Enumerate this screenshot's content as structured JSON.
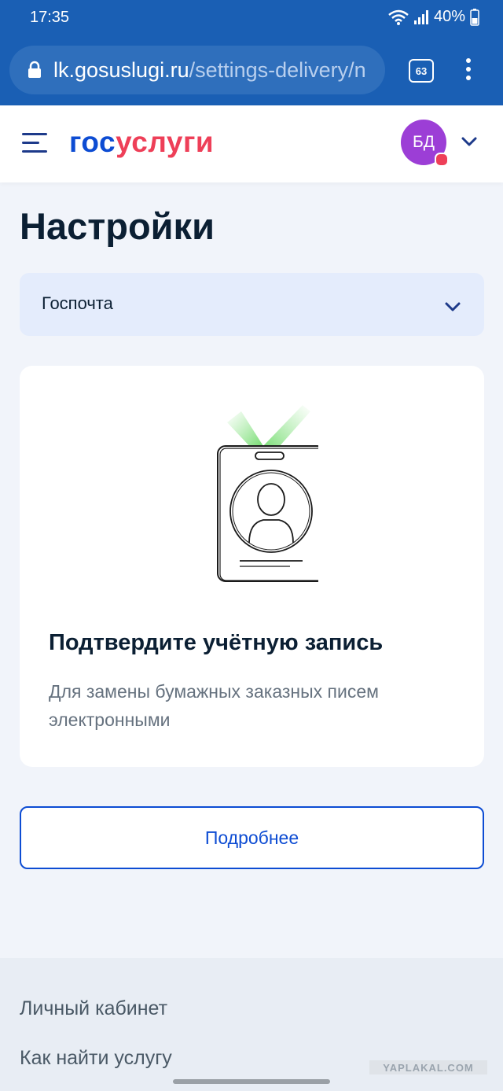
{
  "status_bar": {
    "time": "17:35",
    "battery": "40%"
  },
  "browser": {
    "url_domain": "lk.gosuslugi.ru",
    "url_path": "/settings-delivery/n",
    "tab_count": "63"
  },
  "header": {
    "logo_part1": "гос",
    "logo_part2": "услуги",
    "avatar_initials": "БД"
  },
  "page": {
    "title": "Настройки",
    "dropdown_value": "Госпочта"
  },
  "card": {
    "title": "Подтвердите учётную запись",
    "text": "Для замены бумажных заказных писем электронными"
  },
  "button": {
    "label": "Подробнее"
  },
  "footer": {
    "links": [
      "Личный кабинет",
      "Как найти услугу"
    ]
  },
  "watermark": "YAPLAKAL.COM",
  "colors": {
    "brand_blue": "#0d4cd3",
    "brand_red": "#ee3f58",
    "avatar": "#9c3ed6",
    "browser_bar": "#1a5fb4"
  }
}
